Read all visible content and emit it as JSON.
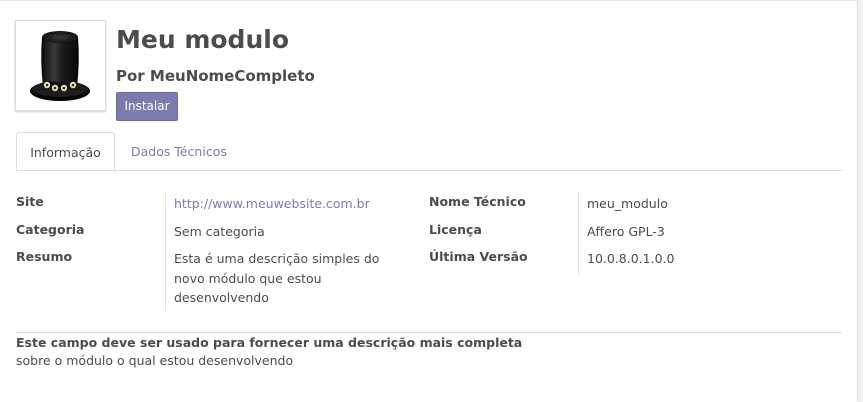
{
  "module": {
    "title": "Meu modulo",
    "author": "Por MeuNomeCompleto",
    "install_label": "Instalar",
    "logo_icon": "top-hat-icon"
  },
  "tabs": [
    {
      "label": "Informação",
      "active": true
    },
    {
      "label": "Dados Técnicos",
      "active": false
    }
  ],
  "info": {
    "left": [
      {
        "label": "Site",
        "value": "http://www.meuwebsite.com.br"
      },
      {
        "label": "Categoria",
        "value": "Sem categoria"
      },
      {
        "label": "Resumo",
        "value": "Esta é uma descrição simples do novo módulo que estou desenvolvendo"
      }
    ],
    "right": [
      {
        "label": "Nome Técnico",
        "value": "meu_modulo"
      },
      {
        "label": "Licença",
        "value": "Affero GPL-3"
      },
      {
        "label": "Última Versão",
        "value": "10.0.8.0.1.0.0"
      }
    ]
  },
  "description": {
    "bold": "Este campo deve ser usado para fornecer uma descrição mais completa",
    "text": "sobre o módulo o qual estou desenvolvendo"
  },
  "colors": {
    "accent": "#7c7bad",
    "text": "#4c4c4c",
    "border": "#dddddd"
  }
}
